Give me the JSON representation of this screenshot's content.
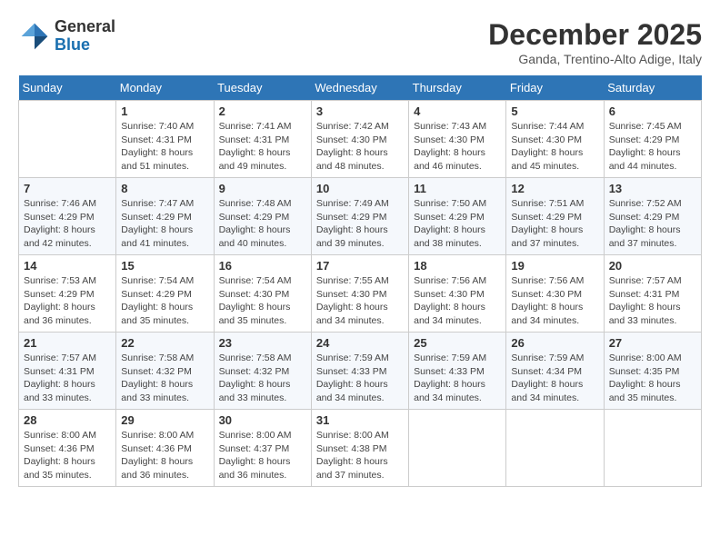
{
  "logo": {
    "general": "General",
    "blue": "Blue"
  },
  "title": "December 2025",
  "subtitle": "Ganda, Trentino-Alto Adige, Italy",
  "weekdays": [
    "Sunday",
    "Monday",
    "Tuesday",
    "Wednesday",
    "Thursday",
    "Friday",
    "Saturday"
  ],
  "weeks": [
    [
      {
        "day": "",
        "info": ""
      },
      {
        "day": "1",
        "info": "Sunrise: 7:40 AM\nSunset: 4:31 PM\nDaylight: 8 hours\nand 51 minutes."
      },
      {
        "day": "2",
        "info": "Sunrise: 7:41 AM\nSunset: 4:31 PM\nDaylight: 8 hours\nand 49 minutes."
      },
      {
        "day": "3",
        "info": "Sunrise: 7:42 AM\nSunset: 4:30 PM\nDaylight: 8 hours\nand 48 minutes."
      },
      {
        "day": "4",
        "info": "Sunrise: 7:43 AM\nSunset: 4:30 PM\nDaylight: 8 hours\nand 46 minutes."
      },
      {
        "day": "5",
        "info": "Sunrise: 7:44 AM\nSunset: 4:30 PM\nDaylight: 8 hours\nand 45 minutes."
      },
      {
        "day": "6",
        "info": "Sunrise: 7:45 AM\nSunset: 4:29 PM\nDaylight: 8 hours\nand 44 minutes."
      }
    ],
    [
      {
        "day": "7",
        "info": "Sunrise: 7:46 AM\nSunset: 4:29 PM\nDaylight: 8 hours\nand 42 minutes."
      },
      {
        "day": "8",
        "info": "Sunrise: 7:47 AM\nSunset: 4:29 PM\nDaylight: 8 hours\nand 41 minutes."
      },
      {
        "day": "9",
        "info": "Sunrise: 7:48 AM\nSunset: 4:29 PM\nDaylight: 8 hours\nand 40 minutes."
      },
      {
        "day": "10",
        "info": "Sunrise: 7:49 AM\nSunset: 4:29 PM\nDaylight: 8 hours\nand 39 minutes."
      },
      {
        "day": "11",
        "info": "Sunrise: 7:50 AM\nSunset: 4:29 PM\nDaylight: 8 hours\nand 38 minutes."
      },
      {
        "day": "12",
        "info": "Sunrise: 7:51 AM\nSunset: 4:29 PM\nDaylight: 8 hours\nand 37 minutes."
      },
      {
        "day": "13",
        "info": "Sunrise: 7:52 AM\nSunset: 4:29 PM\nDaylight: 8 hours\nand 37 minutes."
      }
    ],
    [
      {
        "day": "14",
        "info": "Sunrise: 7:53 AM\nSunset: 4:29 PM\nDaylight: 8 hours\nand 36 minutes."
      },
      {
        "day": "15",
        "info": "Sunrise: 7:54 AM\nSunset: 4:29 PM\nDaylight: 8 hours\nand 35 minutes."
      },
      {
        "day": "16",
        "info": "Sunrise: 7:54 AM\nSunset: 4:30 PM\nDaylight: 8 hours\nand 35 minutes."
      },
      {
        "day": "17",
        "info": "Sunrise: 7:55 AM\nSunset: 4:30 PM\nDaylight: 8 hours\nand 34 minutes."
      },
      {
        "day": "18",
        "info": "Sunrise: 7:56 AM\nSunset: 4:30 PM\nDaylight: 8 hours\nand 34 minutes."
      },
      {
        "day": "19",
        "info": "Sunrise: 7:56 AM\nSunset: 4:30 PM\nDaylight: 8 hours\nand 34 minutes."
      },
      {
        "day": "20",
        "info": "Sunrise: 7:57 AM\nSunset: 4:31 PM\nDaylight: 8 hours\nand 33 minutes."
      }
    ],
    [
      {
        "day": "21",
        "info": "Sunrise: 7:57 AM\nSunset: 4:31 PM\nDaylight: 8 hours\nand 33 minutes."
      },
      {
        "day": "22",
        "info": "Sunrise: 7:58 AM\nSunset: 4:32 PM\nDaylight: 8 hours\nand 33 minutes."
      },
      {
        "day": "23",
        "info": "Sunrise: 7:58 AM\nSunset: 4:32 PM\nDaylight: 8 hours\nand 33 minutes."
      },
      {
        "day": "24",
        "info": "Sunrise: 7:59 AM\nSunset: 4:33 PM\nDaylight: 8 hours\nand 34 minutes."
      },
      {
        "day": "25",
        "info": "Sunrise: 7:59 AM\nSunset: 4:33 PM\nDaylight: 8 hours\nand 34 minutes."
      },
      {
        "day": "26",
        "info": "Sunrise: 7:59 AM\nSunset: 4:34 PM\nDaylight: 8 hours\nand 34 minutes."
      },
      {
        "day": "27",
        "info": "Sunrise: 8:00 AM\nSunset: 4:35 PM\nDaylight: 8 hours\nand 35 minutes."
      }
    ],
    [
      {
        "day": "28",
        "info": "Sunrise: 8:00 AM\nSunset: 4:36 PM\nDaylight: 8 hours\nand 35 minutes."
      },
      {
        "day": "29",
        "info": "Sunrise: 8:00 AM\nSunset: 4:36 PM\nDaylight: 8 hours\nand 36 minutes."
      },
      {
        "day": "30",
        "info": "Sunrise: 8:00 AM\nSunset: 4:37 PM\nDaylight: 8 hours\nand 36 minutes."
      },
      {
        "day": "31",
        "info": "Sunrise: 8:00 AM\nSunset: 4:38 PM\nDaylight: 8 hours\nand 37 minutes."
      },
      {
        "day": "",
        "info": ""
      },
      {
        "day": "",
        "info": ""
      },
      {
        "day": "",
        "info": ""
      }
    ]
  ]
}
